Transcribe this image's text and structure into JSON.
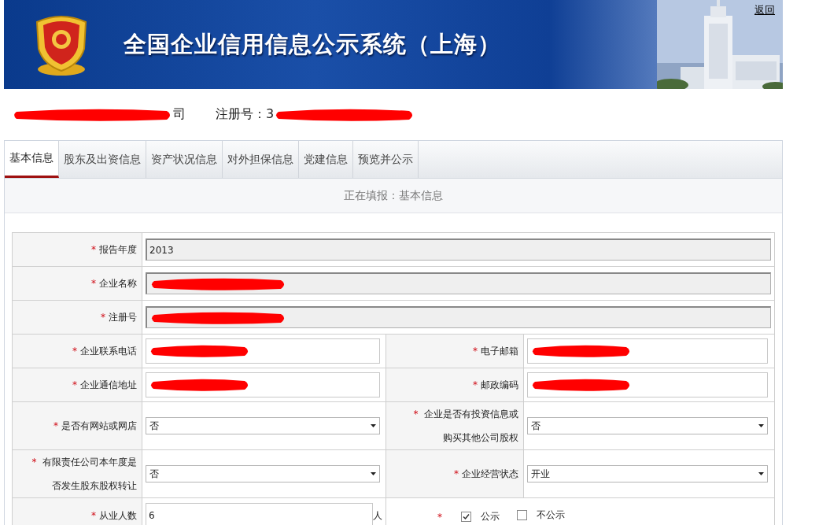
{
  "header": {
    "title": "全国企业信用信息公示系统（上海）",
    "back_link": "返回"
  },
  "company_line": {
    "name_fragment": "司",
    "reg_label": "注册号：3",
    "redacted": true
  },
  "tabs": [
    {
      "label": "基本信息",
      "selected": true
    },
    {
      "label": "股东及出资信息",
      "selected": false
    },
    {
      "label": "资产状况信息",
      "selected": false
    },
    {
      "label": "对外担保信息",
      "selected": false
    },
    {
      "label": "党建信息",
      "selected": false
    },
    {
      "label": "预览并公示",
      "selected": false
    }
  ],
  "status_text": "正在填报：基本信息",
  "form": {
    "rows": [
      {
        "cells": [
          {
            "required_mark": "*",
            "label": "报告年度",
            "kind": "readonly",
            "value": "2013"
          }
        ]
      },
      {
        "cells": [
          {
            "required_mark": "*",
            "label": "企业名称",
            "kind": "readonly",
            "redacted": true
          }
        ]
      },
      {
        "cells": [
          {
            "required_mark": "*",
            "label": "注册号",
            "kind": "readonly",
            "redacted": true
          }
        ]
      },
      {
        "cells": [
          {
            "required_mark": "*",
            "label": "企业联系电话",
            "kind": "text",
            "redacted": true
          },
          {
            "required_mark": "*",
            "label": "电子邮箱",
            "kind": "text",
            "redacted": true
          }
        ]
      },
      {
        "cells": [
          {
            "required_mark": "*",
            "label": "企业通信地址",
            "kind": "text",
            "redacted": true
          },
          {
            "required_mark": "*",
            "label": "邮政编码",
            "kind": "text",
            "redacted": true
          }
        ]
      },
      {
        "cells": [
          {
            "required_mark": "*",
            "label": "是否有网站或网店",
            "kind": "select",
            "value": "否"
          },
          {
            "required_mark": "*",
            "label": "企业是否有投资信息或购买其他公司股权",
            "kind": "select",
            "value": "否"
          }
        ]
      },
      {
        "cells": [
          {
            "required_mark": "*",
            "label": "有限责任公司本年度是否发生股东股权转让",
            "kind": "select",
            "value": "否"
          },
          {
            "required_mark": "*",
            "label": "企业经营状态",
            "kind": "select",
            "value": "开业"
          }
        ]
      },
      {
        "cells": [
          {
            "required_mark": "*",
            "label": "从业人数",
            "kind": "text",
            "value": "6",
            "suffix": "人"
          },
          {
            "kind": "publicity",
            "required_mark": "*",
            "options": [
              {
                "label": "公示",
                "checked": true
              },
              {
                "label": "不公示",
                "checked": false
              }
            ]
          }
        ]
      }
    ]
  }
}
